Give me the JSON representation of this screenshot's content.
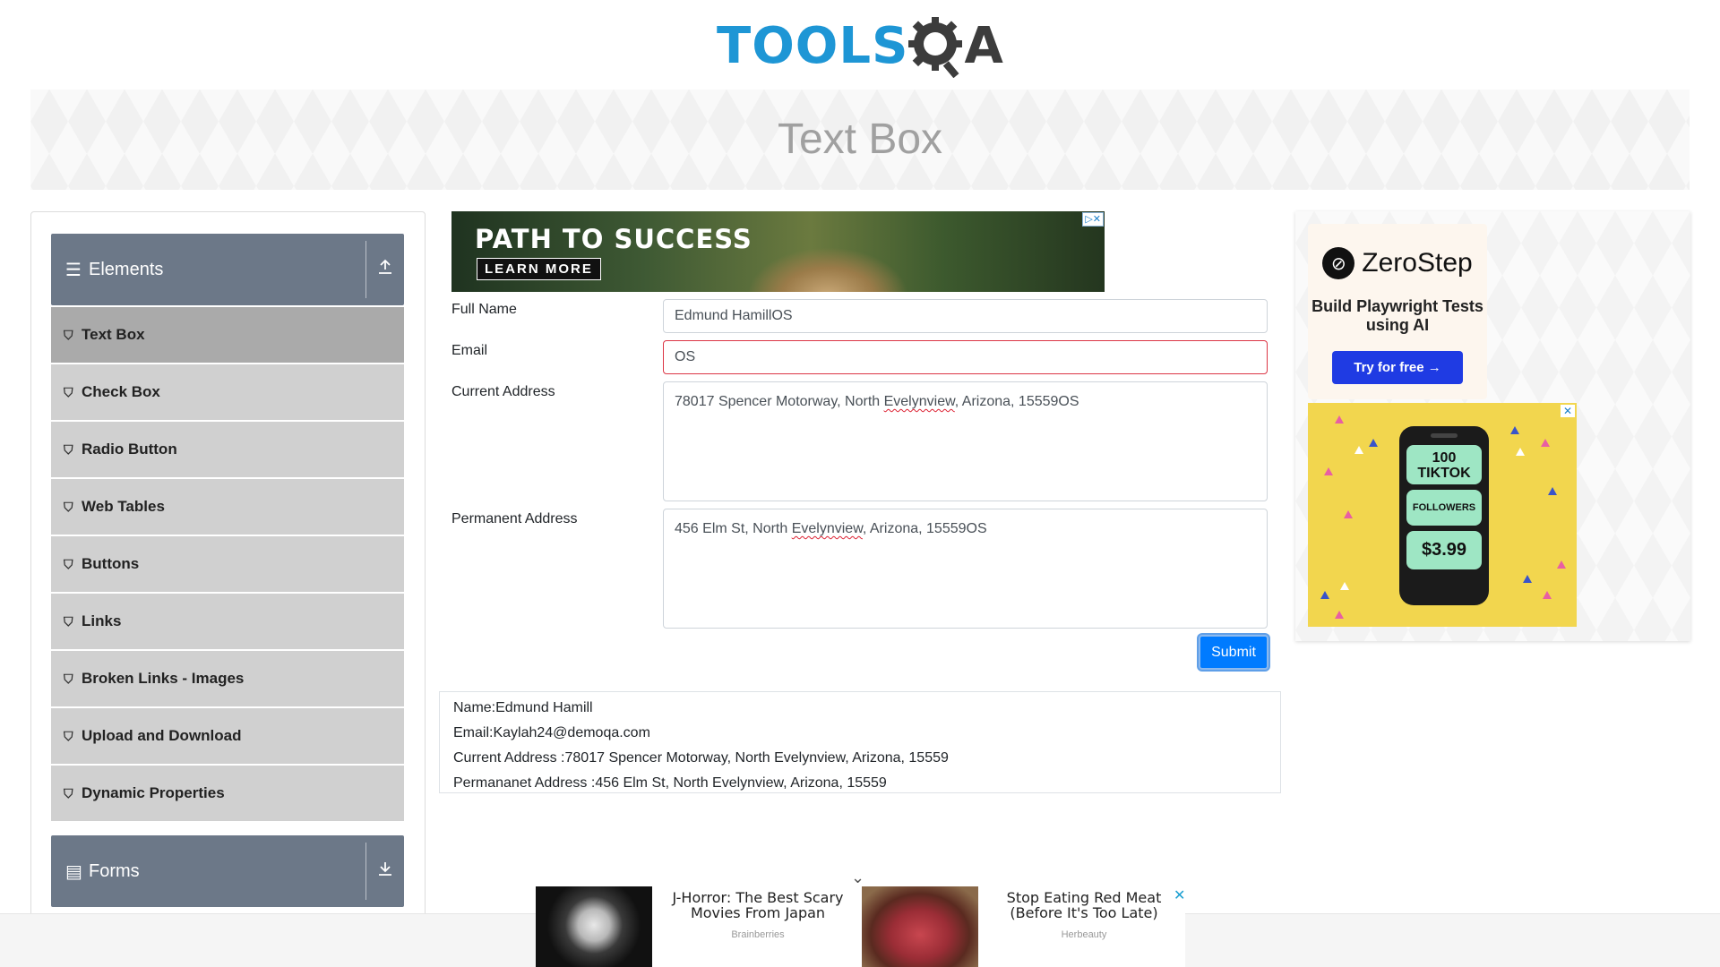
{
  "header": {
    "logo_tools": "TOOLS",
    "logo_q": "Q",
    "logo_a": "A",
    "page_title": "Text Box"
  },
  "sidebar": {
    "elements_group": {
      "label": "Elements",
      "icon": "hamburger-icon",
      "toggle_icon": "collapse-up-icon"
    },
    "items": [
      {
        "label": "Text Box",
        "active": true
      },
      {
        "label": "Check Box"
      },
      {
        "label": "Radio Button"
      },
      {
        "label": "Web Tables"
      },
      {
        "label": "Buttons"
      },
      {
        "label": "Links"
      },
      {
        "label": "Broken Links - Images"
      },
      {
        "label": "Upload and Download"
      },
      {
        "label": "Dynamic Properties"
      }
    ],
    "forms_group": {
      "label": "Forms",
      "icon": "document-icon",
      "toggle_icon": "expand-down-icon"
    }
  },
  "ad_top": {
    "title": "PATH TO SUCCESS",
    "button": "LEARN MORE"
  },
  "form": {
    "full_name_label": "Full Name",
    "full_name_value": "Edmund HamillOS",
    "email_label": "Email",
    "email_value": "OS",
    "current_address_label": "Current Address",
    "current_address_pre": "78017 Spencer Motorway, North ",
    "current_address_misspelled": "Evelynview",
    "current_address_post": ", Arizona, 15559OS",
    "permanent_address_label": "Permanent Address",
    "permanent_address_pre": "456 Elm St, North ",
    "permanent_address_misspelled": "Evelynview",
    "permanent_address_post": ", Arizona, 15559OS",
    "submit_label": "Submit"
  },
  "output": {
    "name": "Name:Edmund Hamill",
    "email": "Email:Kaylah24@demoqa.com",
    "current_address": "Current Address :78017 Spencer Motorway, North Evelynview, Arizona, 15559",
    "permanent_address": "Permananet Address :456 Elm St, North Evelynview, Arizona, 15559"
  },
  "ad_right": {
    "brand": "ZeroStep",
    "tagline": "Build Playwright Tests using AI",
    "button": "Try for free →",
    "tiktok_count": "100",
    "tiktok_word": "TIKTOK",
    "tiktok_followers": "FOLLOWERS",
    "tiktok_price": "$3.99"
  },
  "bottom_ads": [
    {
      "title": "J-Horror: The Best Scary Movies From Japan",
      "source": "Brainberries"
    },
    {
      "title": "Stop Eating Red Meat (Before It's Too Late)",
      "source": "Herbeauty"
    }
  ],
  "colors": {
    "brand_blue": "#1e96d5",
    "sidebar_header": "#6c7888",
    "submit": "#007bff",
    "error_border": "#dc3545"
  }
}
